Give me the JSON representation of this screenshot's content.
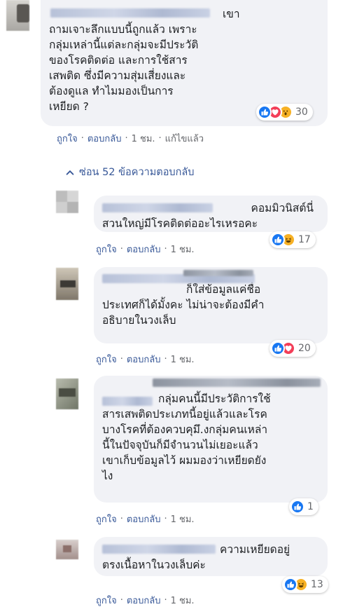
{
  "comments": [
    {
      "text": "เขา\nถามเจาะลึกแบบนี้ถูกแล้ว เพราะ\nกลุ่มเหล่านี้แต่ละกลุ่มจะมีประวัติ\nของโรคติดต่อ และการใช้สาร\nเสพติด ซึ่งมีความสุ่มเสี่ยงและ\nต้องดูแล ทำไมมองเป็นการ\nเหยียด ?",
      "reaction_count": "30",
      "reaction_icons": [
        "like-icon",
        "love-icon",
        "wow-icon"
      ],
      "actions": {
        "like": "ถูกใจ",
        "reply": "ตอบกลับ",
        "time": "1 ชม.",
        "edited": "แก้ไขแล้ว"
      }
    }
  ],
  "toggle": {
    "label": "ซ่อน 52 ข้อความตอบกลับ"
  },
  "replies": [
    {
      "text_first": "คอมมิวนิสต์นี่",
      "text_rest": "สวนใหญ่มีโรคติดต่ออะไรเหรอคะ",
      "reaction_count": "17",
      "reaction_icons": [
        "like-icon",
        "haha-icon"
      ],
      "actions": {
        "like": "ถูกใจ",
        "reply": "ตอบกลับ",
        "time": "1 ชม."
      }
    },
    {
      "text_first": "ก็ใส่ข้อมูลแค่ชื่อ",
      "text_rest": "ประเทศก็ได้มั้งคะ ไม่น่าจะต้องมีคำ\nอธิบายในวงเล็บ",
      "reaction_count": "20",
      "reaction_icons": [
        "like-icon",
        "love-icon"
      ],
      "actions": {
        "like": "ถูกใจ",
        "reply": "ตอบกลับ",
        "time": "1 ชม."
      }
    },
    {
      "text_first": "กลุ่มคนนี้มีประวัติการใช้",
      "text_rest": "สารเสพติดประเภทนี้อยู่แล้วและโรค\nบางโรคที่ต้องควบคุมึ.งกลุ่มคนเหล่า\nนี้ในปัจจุบันก็มีจำนวนไม่เยอะแล้ว\nเขาเก็บข้อมูลไว้ ผมมองว่าเหยียดยัง\nไง",
      "reaction_count": "1",
      "reaction_icons": [
        "like-icon"
      ],
      "actions": {
        "like": "ถูกใจ",
        "reply": "ตอบกลับ",
        "time": "1 ชม."
      }
    },
    {
      "text_first": "ความเหยียดอยู่",
      "text_rest": "ตรงเนื้อหาในวงเล็บค่ะ",
      "reaction_count": "13",
      "reaction_icons": [
        "like-icon",
        "haha-icon"
      ],
      "actions": {
        "like": "ถูกใจ",
        "reply": "ตอบกลับ",
        "time": "1 ชม."
      }
    }
  ],
  "colors": {
    "link": "#385898",
    "meta": "#65676b",
    "bubble": "#f1f2f6",
    "like": "#1877f2",
    "love": "#f33e58",
    "wow": "#f7b125"
  }
}
